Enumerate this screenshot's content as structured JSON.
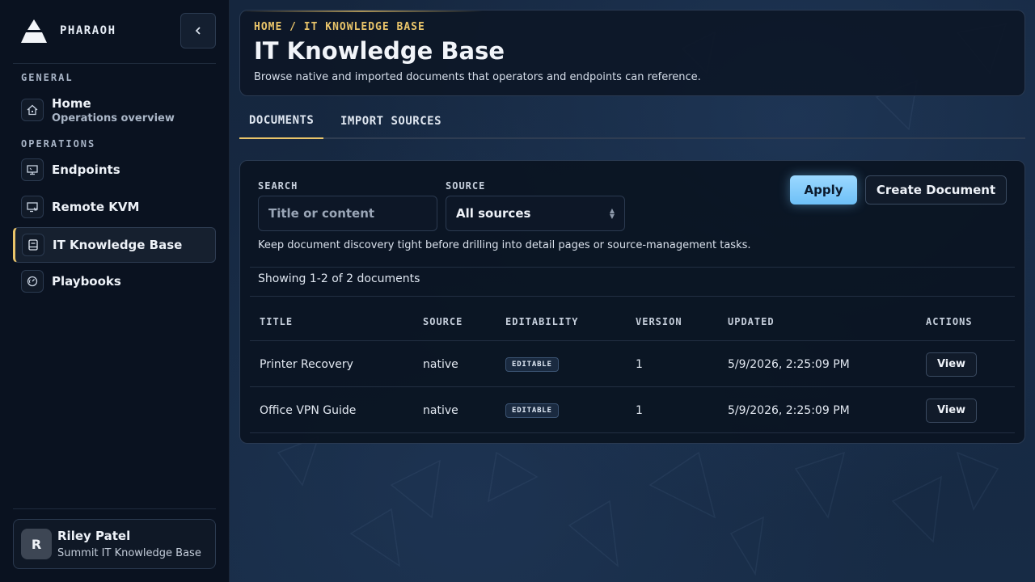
{
  "brand": {
    "name": "PHARAOH",
    "logo": "pyramid-logo"
  },
  "sidebar": {
    "collapse_icon": "chevron-left-icon",
    "sections": [
      {
        "label": "GENERAL"
      },
      {
        "label": "OPERATIONS"
      }
    ],
    "items": [
      {
        "label": "Home",
        "sublabel": "Operations overview",
        "icon": "home-icon"
      },
      {
        "label": "Endpoints",
        "icon": "monitor-icon"
      },
      {
        "label": "Remote KVM",
        "icon": "remote-screen-icon"
      },
      {
        "label": "IT Knowledge Base",
        "icon": "book-icon",
        "active": true
      },
      {
        "label": "Playbooks",
        "icon": "gauge-icon"
      }
    ],
    "user": {
      "initial": "R",
      "name": "Riley Patel",
      "org": "Summit IT Knowledge Base"
    }
  },
  "header": {
    "breadcrumb": "HOME / IT KNOWLEDGE BASE",
    "title": "IT Knowledge Base",
    "description": "Browse native and imported documents that operators and endpoints can reference."
  },
  "tabs": [
    {
      "label": "DOCUMENTS",
      "active": true
    },
    {
      "label": "IMPORT SOURCES",
      "active": false
    }
  ],
  "filters": {
    "search_label": "SEARCH",
    "search_placeholder": "Title or content",
    "search_value": "",
    "source_label": "SOURCE",
    "source_value": "All sources",
    "apply_label": "Apply",
    "create_label": "Create Document",
    "hint": "Keep document discovery tight before drilling into detail pages or source-management tasks."
  },
  "results": {
    "count_text": "Showing 1-2 of 2 documents"
  },
  "table": {
    "columns": [
      "TITLE",
      "SOURCE",
      "EDITABILITY",
      "VERSION",
      "UPDATED",
      "ACTIONS"
    ],
    "rows": [
      {
        "title": "Printer Recovery",
        "source": "native",
        "editability": "EDITABLE",
        "version": "1",
        "updated": "5/9/2026, 2:25:09 PM",
        "action": "View"
      },
      {
        "title": "Office VPN Guide",
        "source": "native",
        "editability": "EDITABLE",
        "version": "1",
        "updated": "5/9/2026, 2:25:09 PM",
        "action": "View"
      }
    ]
  },
  "colors": {
    "accent_gold": "#e9c46a",
    "accent_blue": "#7cc8f9",
    "background": "#14243b",
    "sidebar": "#0a1220"
  }
}
